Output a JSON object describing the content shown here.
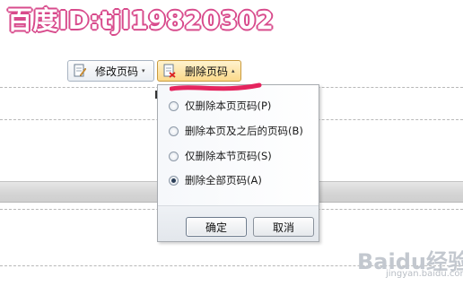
{
  "watermark": {
    "text": "百度ID:tjl19820302"
  },
  "toolbar": {
    "modify": {
      "label": "修改页码",
      "arrow": "▾"
    },
    "delete": {
      "label": "删除页码",
      "arrow": "▴"
    }
  },
  "popup": {
    "options": [
      {
        "label": "仅删除本页页码(P)",
        "selected": false
      },
      {
        "label": "删除本页及之后的页码(B)",
        "selected": false
      },
      {
        "label": "仅删除本节页码(S)",
        "selected": false
      },
      {
        "label": "删除全部页码(A)",
        "selected": true
      }
    ],
    "ok_label": "确定",
    "cancel_label": "取消"
  },
  "logo": {
    "text": "Baidu经验",
    "sub": "jingyan.baidu.com"
  },
  "colors": {
    "watermark": "#d84b8c",
    "pink_stroke": "#e5245e",
    "active_button": "#fbd98a"
  }
}
